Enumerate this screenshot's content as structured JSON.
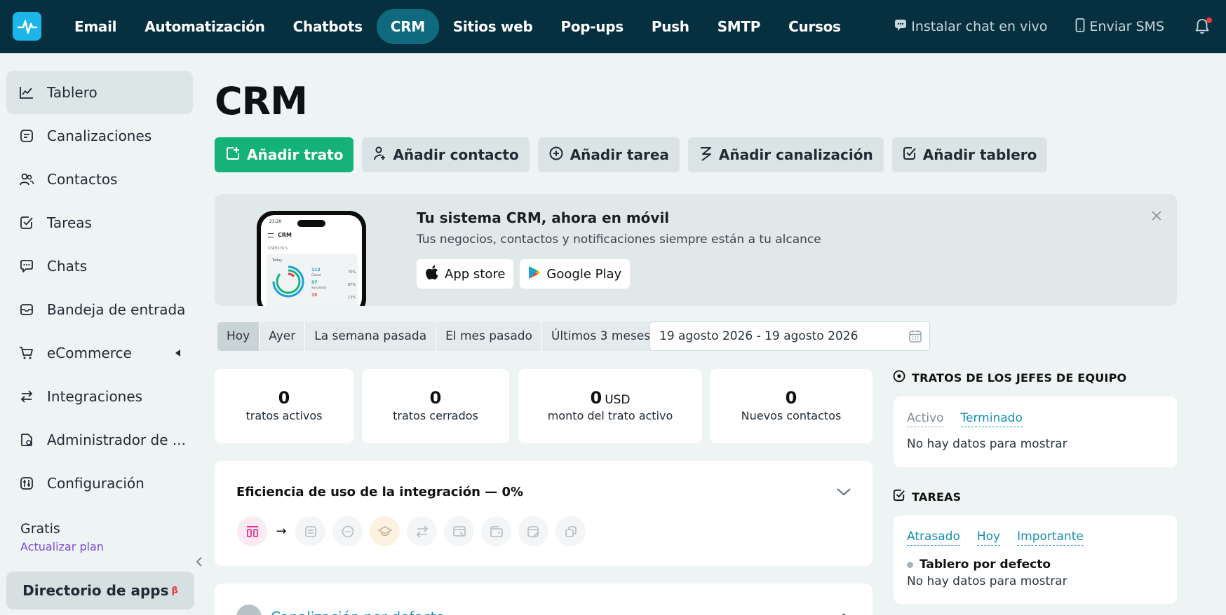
{
  "topnav": {
    "items": [
      "Email",
      "Automatización",
      "Chatbots",
      "CRM",
      "Sitios web",
      "Pop-ups",
      "Push",
      "SMTP",
      "Cursos"
    ],
    "active": "CRM",
    "live_chat": "Instalar chat en vivo",
    "sms": "Enviar SMS"
  },
  "sidebar": {
    "items": [
      {
        "label": "Tablero",
        "icon": "chart-line-icon"
      },
      {
        "label": "Canalizaciones",
        "icon": "pipeline-icon"
      },
      {
        "label": "Contactos",
        "icon": "contacts-icon"
      },
      {
        "label": "Tareas",
        "icon": "tasks-icon"
      },
      {
        "label": "Chats",
        "icon": "chat-icon"
      },
      {
        "label": "Bandeja de entrada",
        "icon": "inbox-icon"
      },
      {
        "label": "eCommerce",
        "icon": "cart-icon"
      },
      {
        "label": "Integraciones",
        "icon": "integrations-icon"
      },
      {
        "label": "Administrador de ...",
        "icon": "file-manager-icon"
      },
      {
        "label": "Configuración",
        "icon": "settings-icon"
      }
    ],
    "plan": "Gratis",
    "upgrade": "Actualizar plan",
    "app_directory": "Directorio de apps",
    "app_directory_badge": "β"
  },
  "page": {
    "title": "CRM",
    "actions": [
      "Añadir trato",
      "Añadir contacto",
      "Añadir tarea",
      "Añadir canalización",
      "Añadir tablero"
    ]
  },
  "promo": {
    "title": "Tu sistema CRM, ahora en móvil",
    "subtitle": "Tus negocios, contactos y notificaciones siempre están a tu alcance",
    "app_store": "App store",
    "google_play": "Google Play",
    "phone": {
      "time": "23:20",
      "title": "CRM",
      "stat_label": "STATISTICS",
      "period": "Today",
      "rows": [
        {
          "num": "112",
          "label": "Closed",
          "pct": "75%",
          "color": "#1aa0d8"
        },
        {
          "num": "97",
          "label": "Successful",
          "pct": "87%",
          "color": "#14b278"
        },
        {
          "num": "15",
          "label": "",
          "pct": "13%",
          "color": "#e5373d"
        }
      ]
    }
  },
  "filters": {
    "periods": [
      "Hoy",
      "Ayer",
      "La semana pasada",
      "El mes pasado",
      "Últimos 3 meses"
    ],
    "active": "Hoy",
    "date_range": "19 agosto 2026 - 19 agosto 2026"
  },
  "stats": [
    {
      "value": "0",
      "unit": "",
      "label": "tratos activos"
    },
    {
      "value": "0",
      "unit": "",
      "label": "tratos cerrados"
    },
    {
      "value": "0",
      "unit": "USD",
      "label": "monto del trato activo"
    },
    {
      "value": "0",
      "unit": "",
      "label": "Nuevos contactos"
    }
  ],
  "efficiency": {
    "title": "Eficiencia de uso de la integración — 0%"
  },
  "next_section": {
    "title": "Canalización por defecto"
  },
  "team_leads": {
    "title": "TRATOS DE LOS JEFES DE EQUIPO",
    "tabs": [
      "Activo",
      "Terminado"
    ],
    "empty": "No hay datos para mostrar"
  },
  "tasks": {
    "title": "TAREAS",
    "tabs": [
      "Atrasado",
      "Hoy",
      "Importante"
    ],
    "board": "Tablero por defecto",
    "empty": "No hay datos para mostrar"
  },
  "colors": {
    "topbar": "#06303f",
    "primary_green": "#14b278",
    "accent_teal": "#168fb3",
    "nav_active": "#0f6a80"
  }
}
